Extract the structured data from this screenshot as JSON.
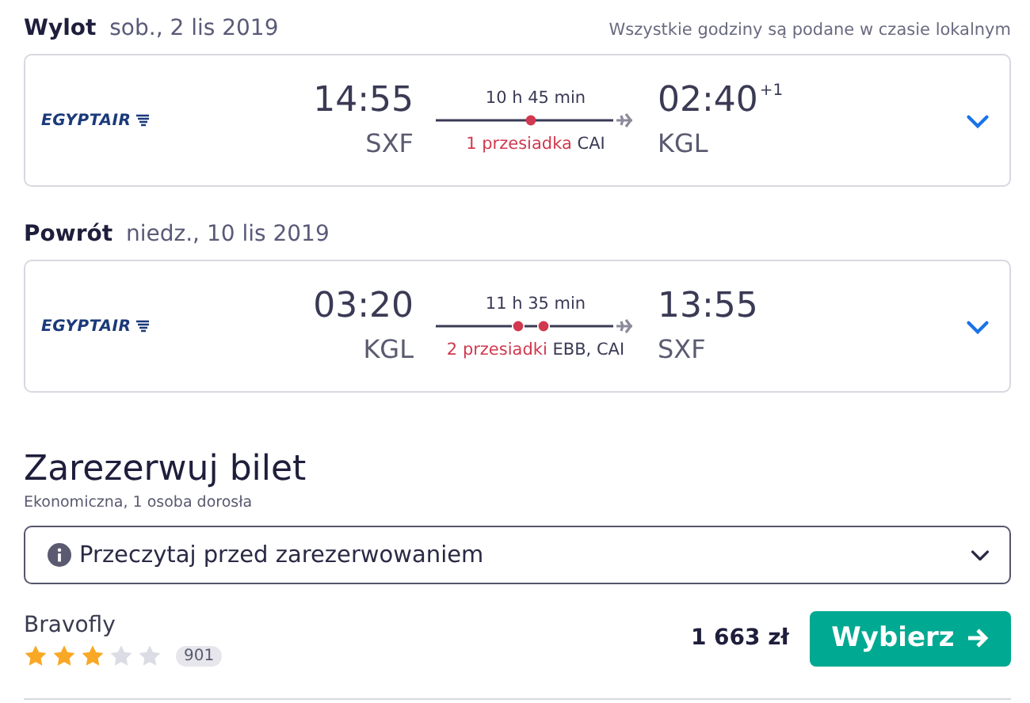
{
  "note": "Wszystkie godziny są podane w czasie lokalnym",
  "legs": [
    {
      "label": "Wylot",
      "date": "sob., 2 lis 2019",
      "airline": "EGYPTAIR",
      "dep_time": "14:55",
      "dep_airport": "SXF",
      "duration": "10 h 45 min",
      "stops": "1 przesiadka",
      "stop_airports": [
        "CAI"
      ],
      "arr_time": "02:40",
      "day_offset": "+1",
      "arr_airport": "KGL",
      "expanded": false
    },
    {
      "label": "Powrót",
      "date": "niedz., 10 lis 2019",
      "airline": "EGYPTAIR",
      "dep_time": "03:20",
      "dep_airport": "KGL",
      "duration": "11 h 35 min",
      "stops": "2 przesiadki",
      "stop_airports": [
        "EBB,",
        "CAI"
      ],
      "arr_time": "13:55",
      "arr_airport": "SXF",
      "expanded": false
    }
  ],
  "booking": {
    "title": "Zarezerwuj bilet",
    "subtitle": "Ekonomiczna, 1 osoba dorosła",
    "notice": "Przeczytaj przed zarezerwowaniem",
    "notice_expanded": false,
    "offers": [
      {
        "provider": "Bravofly",
        "stars": 3,
        "reviews": "901",
        "price": "1 663 zł",
        "button": "Wybierz"
      }
    ]
  }
}
